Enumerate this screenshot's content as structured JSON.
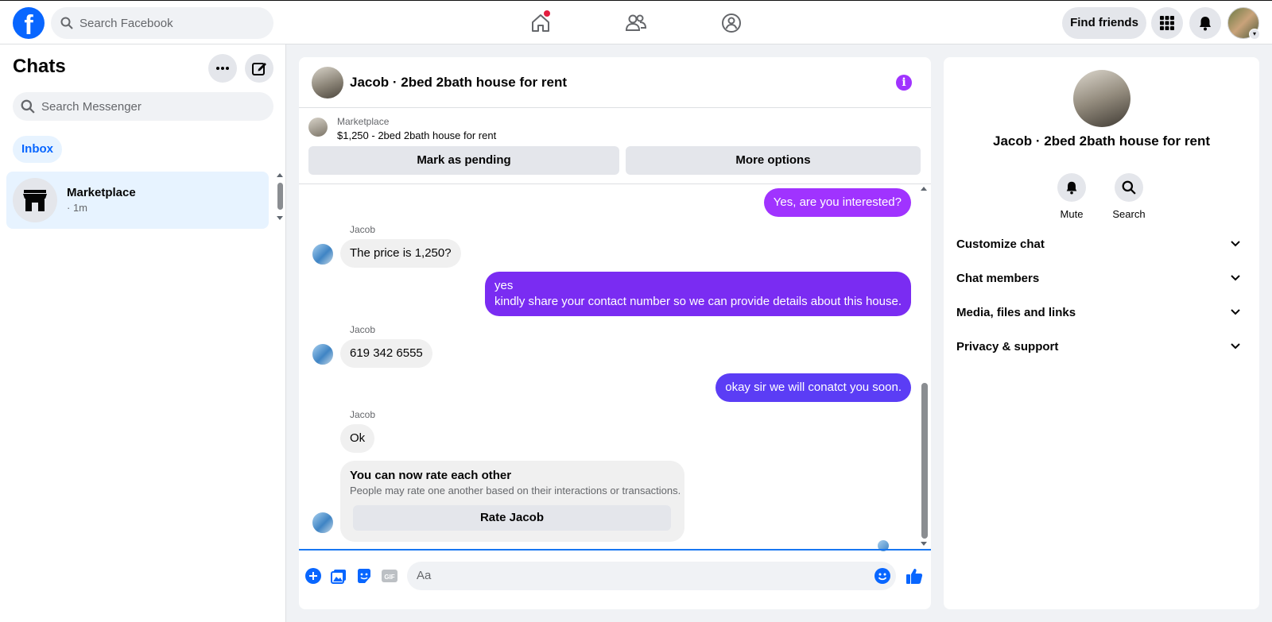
{
  "topbar": {
    "logo_letter": "f",
    "search_placeholder": "Search Facebook",
    "find_friends_label": "Find friends",
    "nav_icons": [
      "home-icon",
      "friends-icon",
      "groups-icon"
    ],
    "accent": "#0866ff"
  },
  "sidebar": {
    "title": "Chats",
    "search_placeholder": "Search Messenger",
    "filter_label": "Inbox",
    "conversations": [
      {
        "name": "Marketplace",
        "time": "· 1m"
      }
    ]
  },
  "chat": {
    "title": "Jacob · 2bed 2bath house for rent",
    "marketplace": {
      "label": "Marketplace",
      "item": "$1,250 - 2bed 2bath house for rent",
      "mark_pending_label": "Mark as pending",
      "more_options_label": "More options"
    },
    "messages": [
      {
        "dir": "out",
        "text": "Yes, are you interested?"
      },
      {
        "dir": "in",
        "sender": "Jacob",
        "text": "The price is 1,250?"
      },
      {
        "dir": "out",
        "lines": [
          "yes",
          "kindly share your contact number so we can provide details about this house."
        ]
      },
      {
        "dir": "in",
        "sender": "Jacob",
        "text": "619 342 6555"
      },
      {
        "dir": "out",
        "text": "okay sir we will conatct you soon."
      },
      {
        "dir": "in",
        "sender": "Jacob",
        "text": "Ok"
      }
    ],
    "rate_card": {
      "title": "You can now rate each other",
      "subtitle": "People may rate one another based on their interactions or transactions.",
      "button_label": "Rate Jacob"
    },
    "composer_placeholder": "Aa",
    "gif_label": "GIF",
    "colors": {
      "out_bubble_1": "#a033ff",
      "out_bubble_2": "#7a2cf2",
      "out_bubble_3": "#5b3df5",
      "in_bubble": "#f0f0f0"
    }
  },
  "details": {
    "title": "Jacob · 2bed 2bath house for rent",
    "actions": [
      {
        "label": "Mute",
        "icon": "bell-icon"
      },
      {
        "label": "Search",
        "icon": "search-icon"
      }
    ],
    "sections": [
      "Customize chat",
      "Chat members",
      "Media, files and links",
      "Privacy & support"
    ]
  }
}
